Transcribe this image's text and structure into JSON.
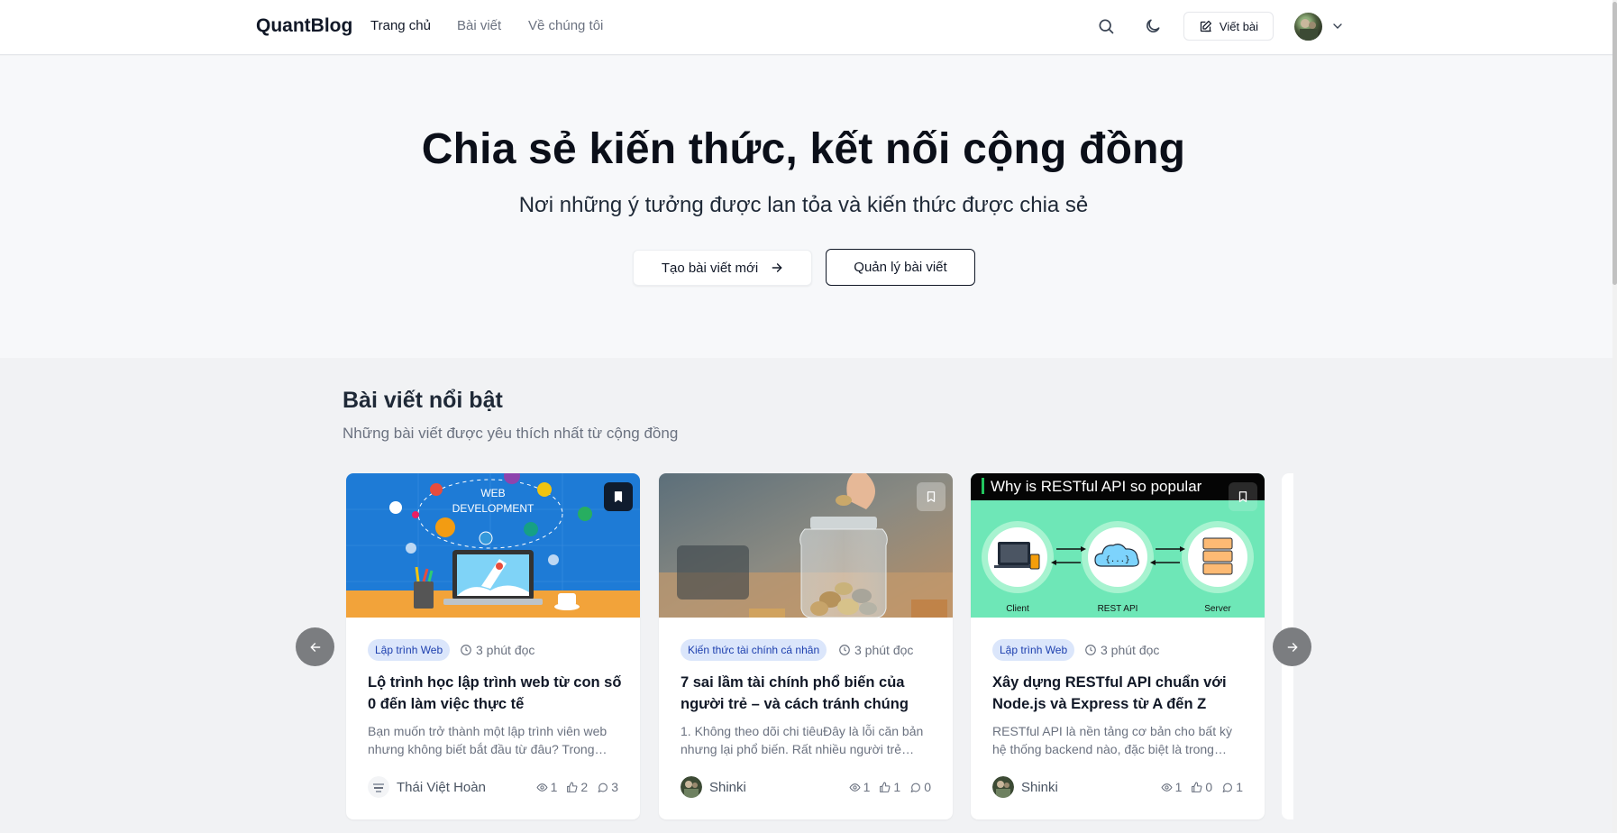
{
  "navbar": {
    "brand": "QuantBlog",
    "links": [
      {
        "label": "Trang chủ",
        "active": true
      },
      {
        "label": "Bài viết",
        "active": false
      },
      {
        "label": "Về chúng tôi",
        "active": false
      }
    ],
    "search_icon": "search-icon",
    "theme_icon": "moon-icon",
    "write_button": "Viết bài",
    "write_icon": "edit-icon"
  },
  "hero": {
    "title": "Chia sẻ kiến thức, kết nối cộng đồng",
    "subtitle": "Nơi những ý tưởng được lan tỏa và kiến thức được chia sẻ",
    "primary_button": "Tạo bài viết mới",
    "secondary_button": "Quản lý bài viết"
  },
  "featured": {
    "title": "Bài viết nổi bật",
    "subtitle": "Những bài viết được yêu thích nhất từ cộng đồng",
    "posts": [
      {
        "category": "Lập trình Web",
        "read_time": "3 phút đọc",
        "title": "Lộ trình học lập trình web từ con số 0 đến làm việc thực tế",
        "excerpt": "Bạn muốn trở thành một lập trình viên web nhưng không biết bắt đầu từ đâu? Trong…",
        "author": "Thái Việt Hoàn",
        "views": "1",
        "likes": "2",
        "comments": "3",
        "bookmarked": true,
        "image_text": [
          "WEB",
          "DEVELOPMENT"
        ]
      },
      {
        "category": "Kiến thức tài chính cá nhân",
        "read_time": "3 phút đọc",
        "title": "7 sai lầm tài chính phổ biến của người trẻ – và cách tránh chúng",
        "excerpt": "1. Không theo dõi chi tiêuĐây là lỗi căn bản nhưng lại phổ biến. Rất nhiều người trẻ…",
        "author": "Shinki",
        "views": "1",
        "likes": "1",
        "comments": "0",
        "bookmarked": false
      },
      {
        "category": "Lập trình Web",
        "read_time": "3 phút đọc",
        "title": "Xây dựng RESTful API chuẩn với Node.js và Express từ A đến Z",
        "excerpt": "RESTful API là nền tảng cơ bản cho bất kỳ hệ thống backend nào, đặc biệt là trong…",
        "author": "Shinki",
        "views": "1",
        "likes": "0",
        "comments": "1",
        "bookmarked": false,
        "image_text": [
          "Why is RESTful API so popular",
          "Client",
          "REST API",
          "Server",
          "{...}"
        ]
      }
    ]
  },
  "colors": {
    "accent_tag_bg": "#dbe6fb",
    "accent_tag_text": "#1e40af",
    "rest_bg": "#6ee7b7"
  }
}
